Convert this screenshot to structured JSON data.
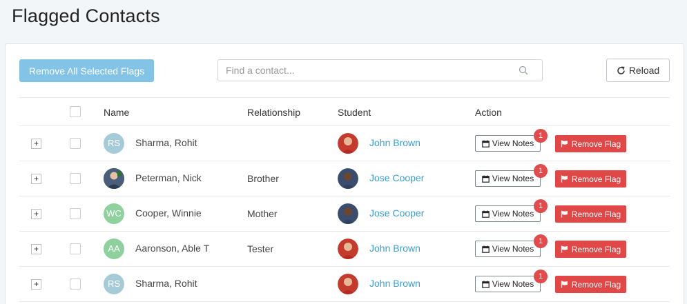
{
  "page": {
    "title": "Flagged Contacts"
  },
  "toolbar": {
    "remove_all_label": "Remove All Selected Flags",
    "search_placeholder": "Find a contact...",
    "reload_label": "Reload"
  },
  "table": {
    "columns": {
      "name": "Name",
      "relationship": "Relationship",
      "student": "Student",
      "action": "Action"
    },
    "rows": [
      {
        "initials": "RS",
        "avatar_color": "#a6cbd8",
        "name": "Sharma, Rohit",
        "relationship": "",
        "student": "John Brown",
        "view_notes": "View Notes",
        "badge": "1",
        "remove_flag": "Remove Flag"
      },
      {
        "initials": "",
        "avatar_color": "#3d4f6a",
        "name": "Peterman, Nick",
        "relationship": "Brother",
        "student": "Jose Cooper",
        "view_notes": "View Notes",
        "badge": "1",
        "remove_flag": "Remove Flag"
      },
      {
        "initials": "WC",
        "avatar_color": "#8fd19e",
        "name": "Cooper, Winnie",
        "relationship": "Mother",
        "student": "Jose Cooper",
        "view_notes": "View Notes",
        "badge": "1",
        "remove_flag": "Remove Flag"
      },
      {
        "initials": "AA",
        "avatar_color": "#8fd19e",
        "name": "Aaronson, Able T",
        "relationship": "Tester",
        "student": "John Brown",
        "view_notes": "View Notes",
        "badge": "1",
        "remove_flag": "Remove Flag"
      },
      {
        "initials": "RS",
        "avatar_color": "#a6cbd8",
        "name": "Sharma, Rohit",
        "relationship": "",
        "student": "John Brown",
        "view_notes": "View Notes",
        "badge": "1",
        "remove_flag": "Remove Flag"
      }
    ]
  }
}
